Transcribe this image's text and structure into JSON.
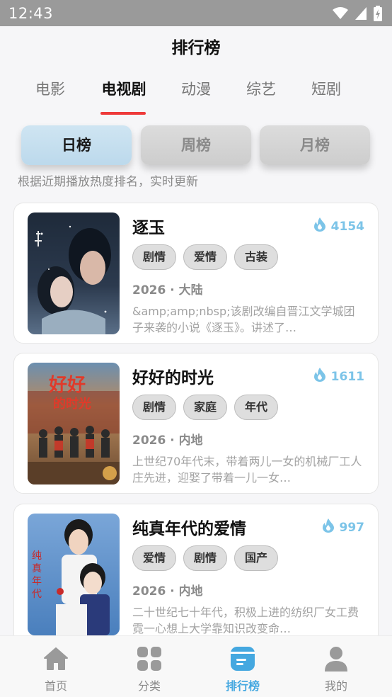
{
  "status_bar": {
    "time": "12:43"
  },
  "header": {
    "title": "排行榜"
  },
  "category_tabs": [
    {
      "label": "电影"
    },
    {
      "label": "电视剧"
    },
    {
      "label": "动漫"
    },
    {
      "label": "综艺"
    },
    {
      "label": "短剧"
    }
  ],
  "active_category": "电视剧",
  "period_tabs": [
    {
      "label": "日榜"
    },
    {
      "label": "周榜"
    },
    {
      "label": "月榜"
    }
  ],
  "active_period": "日榜",
  "hint": "根据近期播放热度排名，实时更新",
  "items": [
    {
      "title": "逐玉",
      "heat": "4154",
      "tags": [
        "剧情",
        "爱情",
        "古装"
      ],
      "meta": "2026 · 大陆",
      "description": "&amp;amp;nbsp;该剧改编自晋江文学城团子来袭的小说《逐玉》。讲述了…",
      "poster_icon": "drama-poster-zhuyu"
    },
    {
      "title": "好好的时光",
      "heat": "1611",
      "tags": [
        "剧情",
        "家庭",
        "年代"
      ],
      "meta": "2026 · 内地",
      "description": "上世纪70年代末，带着两儿一女的机械厂工人庄先进，迎娶了带着一儿一女…",
      "poster_icon": "drama-poster-haohao"
    },
    {
      "title": "纯真年代的爱情",
      "heat": "997",
      "tags": [
        "爱情",
        "剧情",
        "国产"
      ],
      "meta": "2026 · 内地",
      "description": "二十世纪七十年代，积极上进的纺织厂女工费霓一心想上大学靠知识改变命…",
      "poster_icon": "drama-poster-chunzhen"
    }
  ],
  "bottom_nav": [
    {
      "label": "首页",
      "icon": "home-icon"
    },
    {
      "label": "分类",
      "icon": "grid-icon"
    },
    {
      "label": "排行榜",
      "icon": "ranking-icon"
    },
    {
      "label": "我的",
      "icon": "user-icon"
    }
  ],
  "active_nav": "排行榜",
  "colors": {
    "accent_red": "#ee3a3a",
    "accent_blue": "#45a8e0",
    "heat_blue": "#7cc4e8"
  }
}
